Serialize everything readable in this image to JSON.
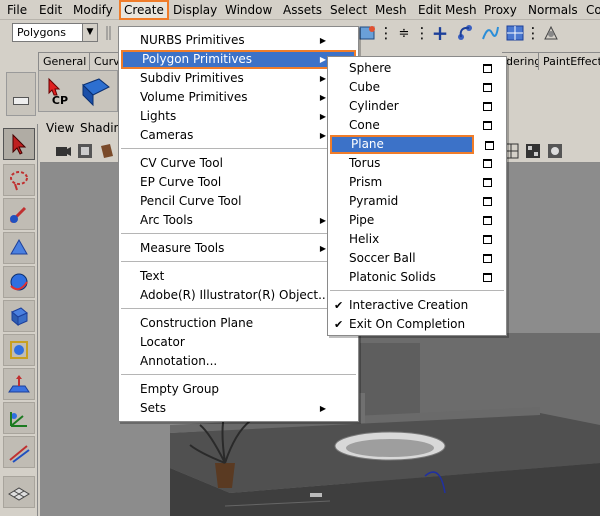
{
  "menubar": {
    "items": [
      "File",
      "Edit",
      "Modify",
      "Create",
      "Display",
      "Window",
      "Assets",
      "Select",
      "Mesh",
      "Edit Mesh",
      "Proxy",
      "Normals",
      "Colo"
    ],
    "active": "Create"
  },
  "mode_select": {
    "value": "Polygons"
  },
  "shelf": {
    "tabs": [
      "General",
      "Curve",
      "dering",
      "PaintEffects"
    ],
    "cp_label": "CP"
  },
  "viewport": {
    "menu": [
      "View",
      "Shadin"
    ]
  },
  "create_menu": {
    "items": [
      {
        "label": "NURBS Primitives",
        "submenu": true
      },
      {
        "label": "Polygon Primitives",
        "submenu": true,
        "highlighted": true
      },
      {
        "label": "Subdiv Primitives",
        "submenu": true
      },
      {
        "label": "Volume Primitives",
        "submenu": true
      },
      {
        "label": "Lights",
        "submenu": true
      },
      {
        "label": "Cameras",
        "submenu": true
      },
      {
        "label": "CV Curve Tool"
      },
      {
        "label": "EP Curve Tool"
      },
      {
        "label": "Pencil Curve Tool"
      },
      {
        "label": "Arc Tools",
        "submenu": true
      },
      {
        "label": "Measure Tools",
        "submenu": true
      },
      {
        "label": "Text"
      },
      {
        "label": "Adobe(R) Illustrator(R) Object..."
      },
      {
        "label": "Construction Plane"
      },
      {
        "label": "Locator"
      },
      {
        "label": "Annotation..."
      },
      {
        "label": "Empty Group"
      },
      {
        "label": "Sets",
        "submenu": true
      }
    ]
  },
  "polygon_primitives_menu": {
    "items": [
      {
        "label": "Sphere",
        "option_box": true
      },
      {
        "label": "Cube",
        "option_box": true
      },
      {
        "label": "Cylinder",
        "option_box": true
      },
      {
        "label": "Cone",
        "option_box": true
      },
      {
        "label": "Plane",
        "option_box": true,
        "highlighted": true
      },
      {
        "label": "Torus",
        "option_box": true
      },
      {
        "label": "Prism",
        "option_box": true
      },
      {
        "label": "Pyramid",
        "option_box": true
      },
      {
        "label": "Pipe",
        "option_box": true
      },
      {
        "label": "Helix",
        "option_box": true
      },
      {
        "label": "Soccer Ball",
        "option_box": true
      },
      {
        "label": "Platonic Solids",
        "option_box": true
      },
      {
        "label": "Interactive Creation",
        "checked": true
      },
      {
        "label": "Exit On Completion",
        "checked": true
      }
    ]
  },
  "colors": {
    "highlight": "#3c72c8",
    "callout": "#f07d2a",
    "ui_gray": "#d4d0c8",
    "viewport": "#8c8c8c"
  }
}
